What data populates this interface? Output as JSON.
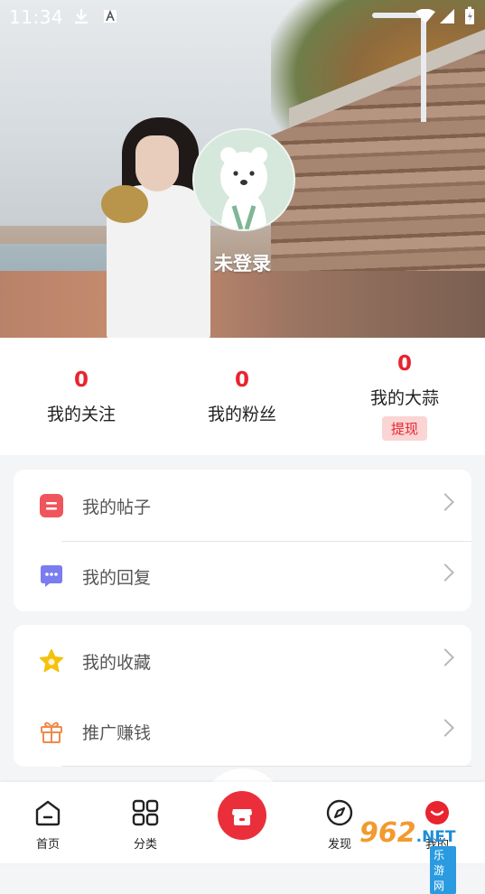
{
  "status_bar": {
    "time": "11:34"
  },
  "profile": {
    "login_text": "未登录"
  },
  "stats": [
    {
      "label": "我的关注",
      "value": "0"
    },
    {
      "label": "我的粉丝",
      "value": "0"
    },
    {
      "label": "我的大蒜",
      "value": "0",
      "action": "提现"
    }
  ],
  "menu_group_1": [
    {
      "label": "我的帖子",
      "icon": "post-icon"
    },
    {
      "label": "我的回复",
      "icon": "reply-icon"
    }
  ],
  "menu_group_2": [
    {
      "label": "我的收藏",
      "icon": "star-icon"
    },
    {
      "label": "推广赚钱",
      "icon": "gift-icon"
    }
  ],
  "tabs": [
    {
      "label": "首页",
      "icon": "home-icon"
    },
    {
      "label": "分类",
      "icon": "category-icon"
    },
    {
      "label": "",
      "icon": "store-icon"
    },
    {
      "label": "发现",
      "icon": "compass-icon"
    },
    {
      "label": "我的",
      "icon": "profile-icon"
    }
  ],
  "watermark": {
    "number": "962",
    "net": ".NET",
    "sub": "乐游网"
  },
  "colors": {
    "accent": "#e8242f",
    "post": "#f0545d",
    "reply": "#7b7cf0",
    "star": "#f4c20d",
    "gift": "#f08a4b"
  }
}
